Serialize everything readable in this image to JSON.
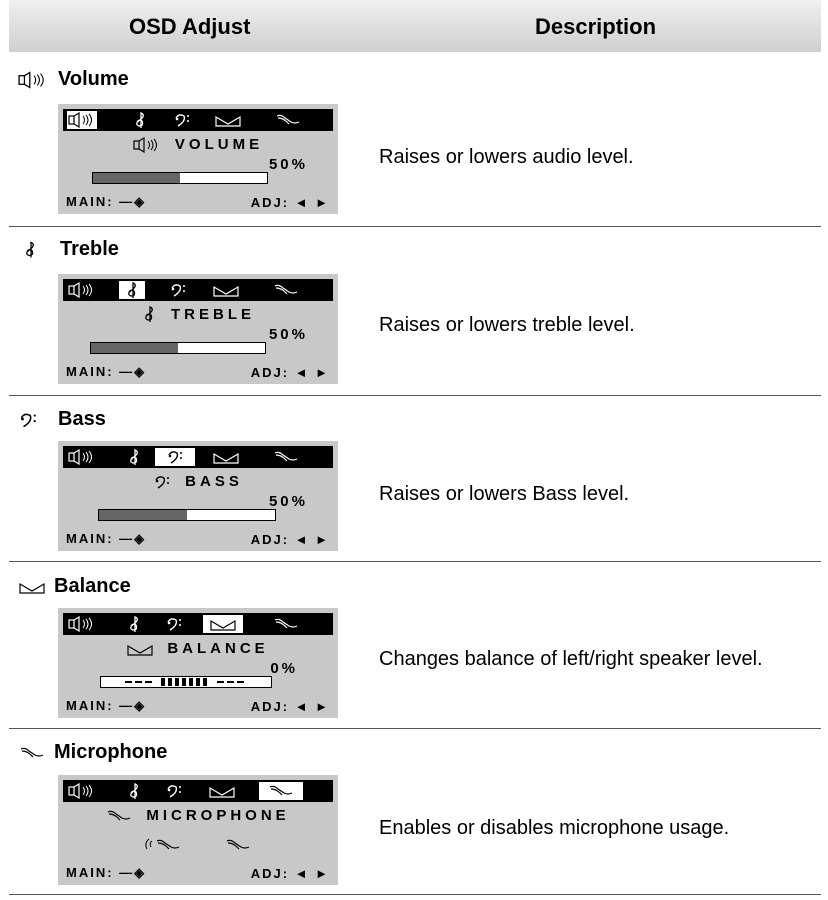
{
  "header": {
    "left": "OSD Adjust",
    "right": "Description"
  },
  "common": {
    "main_label": "MAIN:",
    "adj_label": "ADJ:"
  },
  "sections": [
    {
      "title": "Volume",
      "osd_label": "VOLUME",
      "value": "50%",
      "level": 0.5,
      "description": "Raises or lowers audio level."
    },
    {
      "title": "Treble",
      "osd_label": "TREBLE",
      "value": "50%",
      "level": 0.5,
      "description": "Raises or lowers treble level."
    },
    {
      "title": "Bass",
      "osd_label": "BASS",
      "value": "50%",
      "level": 0.5,
      "description": "Raises or lowers Bass level."
    },
    {
      "title": "Balance",
      "osd_label": "BALANCE",
      "value": "0%",
      "description": "Changes balance of left/right speaker level."
    },
    {
      "title": "Microphone",
      "osd_label": "MICROPHONE",
      "description": "Enables or disables microphone usage."
    }
  ]
}
